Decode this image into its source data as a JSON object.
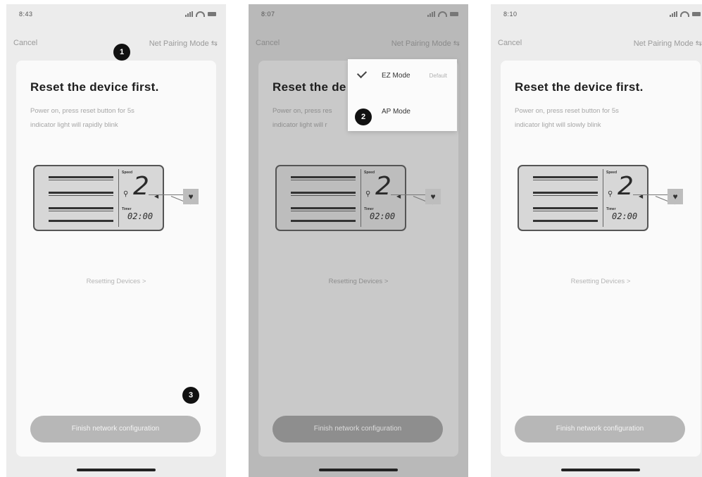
{
  "screens": [
    {
      "status_time": "8:43",
      "cancel_label": "Cancel",
      "mode_label": "Net Pairing Mode",
      "mode_icon": "swap-icon",
      "title": "Reset the device first.",
      "desc_line1": "Power on, press reset button for 5s",
      "desc_line2": "indicator light will rapidly blink",
      "reset_link": "Resetting Devices >",
      "finish_label": "Finish network configuration"
    },
    {
      "status_time": "8:07",
      "cancel_label": "Cancel",
      "mode_label": "Net Pairing Mode",
      "mode_icon": "swap-icon",
      "title": "Reset the de",
      "desc_line1": "Power on, press res",
      "desc_line2": "indicator light will r",
      "reset_link": "Resetting Devices >",
      "finish_label": "Finish network configuration",
      "dropdown": {
        "items": [
          {
            "label": "EZ Mode",
            "tag": "Default",
            "selected": true
          },
          {
            "label": "AP Mode",
            "tag": "",
            "selected": false
          }
        ]
      }
    },
    {
      "status_time": "8:10",
      "cancel_label": "Cancel",
      "mode_label": "Net Pairing Mode",
      "mode_icon": "swap-icon",
      "title": "Reset the device first.",
      "desc_line1": "Power on, press reset button for 5s",
      "desc_line2": "indicator light will slowly blink",
      "reset_link": "Resetting Devices >",
      "finish_label": "Finish network configuration"
    }
  ],
  "lcd": {
    "speed_label": "Speed",
    "speed_value": "2",
    "timer_label": "Timer",
    "timer_value": "02:00",
    "heart_icon": "heart-icon"
  },
  "badges": [
    "1",
    "2",
    "3"
  ]
}
